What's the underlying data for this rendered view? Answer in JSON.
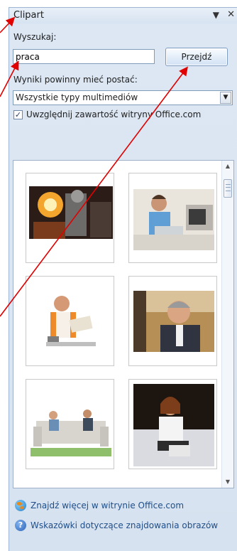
{
  "pane": {
    "title": "Clipart",
    "menu_icon": "dropdown-arrow-icon",
    "close_icon": "close-icon"
  },
  "search": {
    "label": "Wyszukaj:",
    "value": "praca",
    "go_button": "Przejdź"
  },
  "results_filter": {
    "label": "Wyniki powinny mieć postać:",
    "selected": "Wszystkie typy multimediów",
    "include_office_checked": true,
    "include_office_label": "Uwzględnij zawartość witryny Office.com"
  },
  "results": {
    "thumbnails": [
      {
        "name": "foundry-worker-photo",
        "icon": "foundry-image"
      },
      {
        "name": "man-at-laptop-kitchen-photo",
        "icon": "office-man-image"
      },
      {
        "name": "man-reading-book-photo",
        "icon": "reading-man-image"
      },
      {
        "name": "businessman-meeting-photo",
        "icon": "businessman-image"
      },
      {
        "name": "couple-on-sofa-photo",
        "icon": "sofa-couple-image"
      },
      {
        "name": "woman-on-phone-photo",
        "icon": "woman-phone-image"
      }
    ]
  },
  "footer": {
    "more_link": "Znajdź więcej w witrynie Office.com",
    "tips_link": "Wskazówki dotyczące znajdowania obrazów"
  },
  "colors": {
    "annotation_arrow": "#e00000",
    "link": "#1f4e8a",
    "pane_background": "#dbe6f2"
  }
}
